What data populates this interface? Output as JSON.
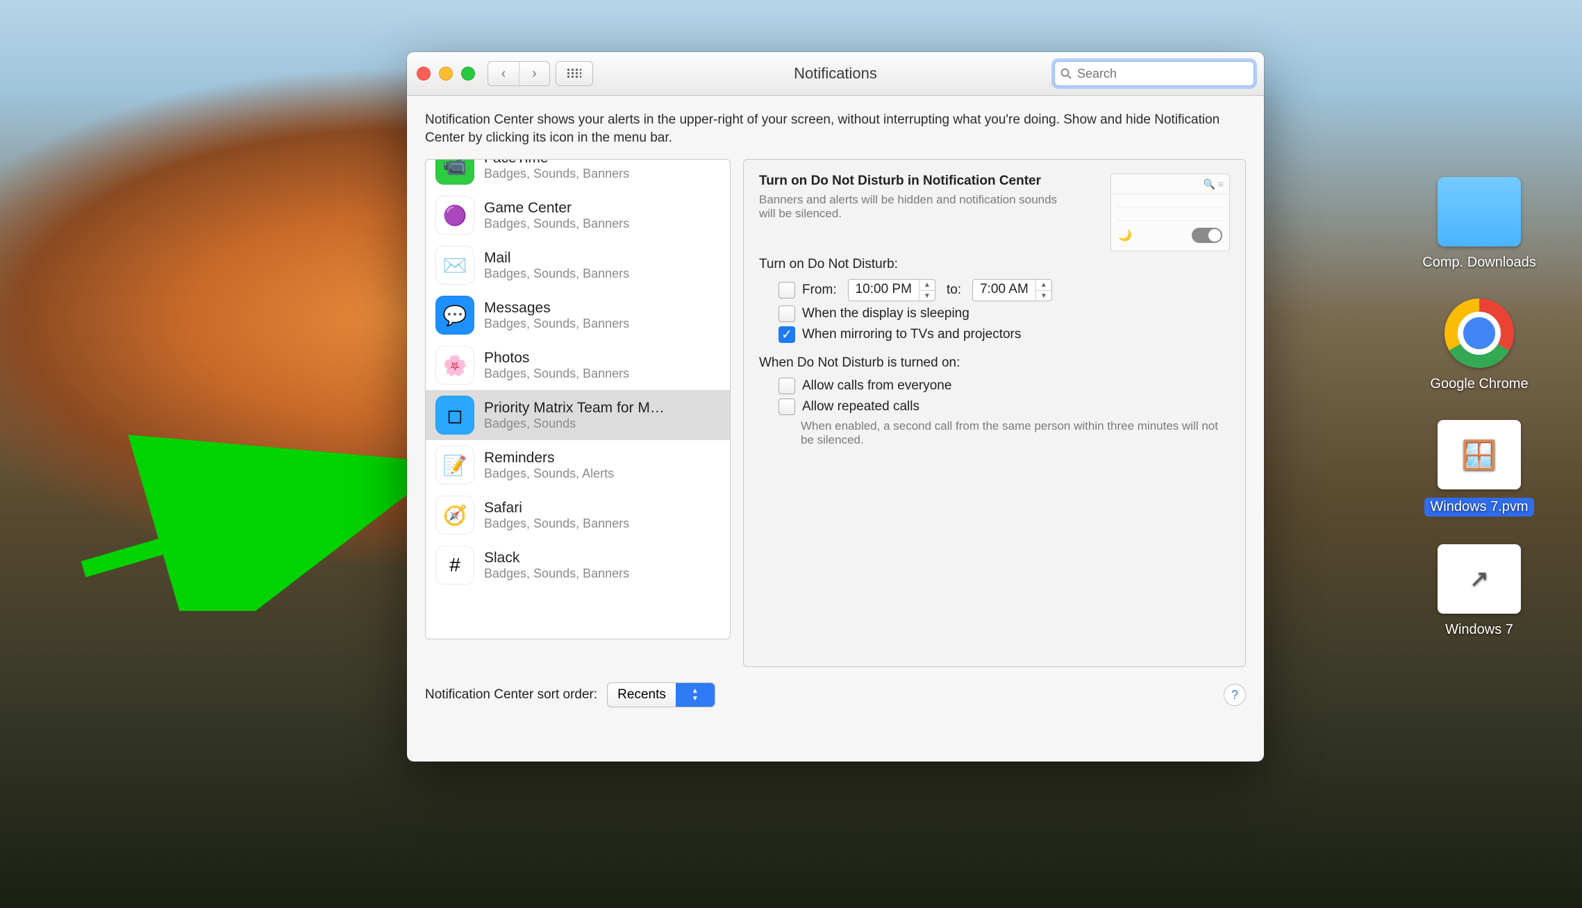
{
  "window": {
    "title": "Notifications",
    "search_placeholder": "Search",
    "description": "Notification Center shows your alerts in the upper-right of your screen, without interrupting what you're doing. Show and hide Notification Center by clicking its icon in the menu bar."
  },
  "apps": [
    {
      "name": "FaceTime",
      "sub": "Badges, Sounds, Banners",
      "color": "#2ecc40",
      "glyph": "📹"
    },
    {
      "name": "Game Center",
      "sub": "Badges, Sounds, Banners",
      "color": "#ffffff",
      "glyph": "🟣"
    },
    {
      "name": "Mail",
      "sub": "Badges, Sounds, Banners",
      "color": "#ffffff",
      "glyph": "✉️"
    },
    {
      "name": "Messages",
      "sub": "Badges, Sounds, Banners",
      "color": "#1e90ff",
      "glyph": "💬"
    },
    {
      "name": "Photos",
      "sub": "Badges, Sounds, Banners",
      "color": "#ffffff",
      "glyph": "🌸"
    },
    {
      "name": "Priority Matrix Team for M…",
      "sub": "Badges, Sounds",
      "color": "#2aa7ff",
      "glyph": "◻",
      "selected": true
    },
    {
      "name": "Reminders",
      "sub": "Badges, Sounds, Alerts",
      "color": "#ffffff",
      "glyph": "📝"
    },
    {
      "name": "Safari",
      "sub": "Badges, Sounds, Banners",
      "color": "#ffffff",
      "glyph": "🧭"
    },
    {
      "name": "Slack",
      "sub": "Badges, Sounds, Banners",
      "color": "#ffffff",
      "glyph": "#"
    }
  ],
  "dnd": {
    "heading": "Turn on Do Not Disturb in Notification Center",
    "help": "Banners and alerts will be hidden and notification sounds will be silenced.",
    "section_turn_on": "Turn on Do Not Disturb:",
    "row_from_label": "From:",
    "row_from_time": "10:00 PM",
    "row_to_label": "to:",
    "row_to_time": "7:00 AM",
    "opt_sleep": "When the display is sleeping",
    "opt_mirror": "When mirroring to TVs and projectors",
    "section_when_on": "When Do Not Disturb is turned on:",
    "opt_allow_all": "Allow calls from everyone",
    "opt_allow_repeat": "Allow repeated calls",
    "repeat_help": "When enabled, a second call from the same person within three minutes will not be silenced."
  },
  "footer": {
    "label": "Notification Center sort order:",
    "value": "Recents"
  },
  "desktop_icons": [
    {
      "label": "Comp. Downloads",
      "type": "folder"
    },
    {
      "label": "Google Chrome",
      "type": "chrome"
    },
    {
      "label": "Windows 7.pvm",
      "type": "pvm",
      "selected": true
    },
    {
      "label": "Windows 7",
      "type": "file"
    }
  ]
}
